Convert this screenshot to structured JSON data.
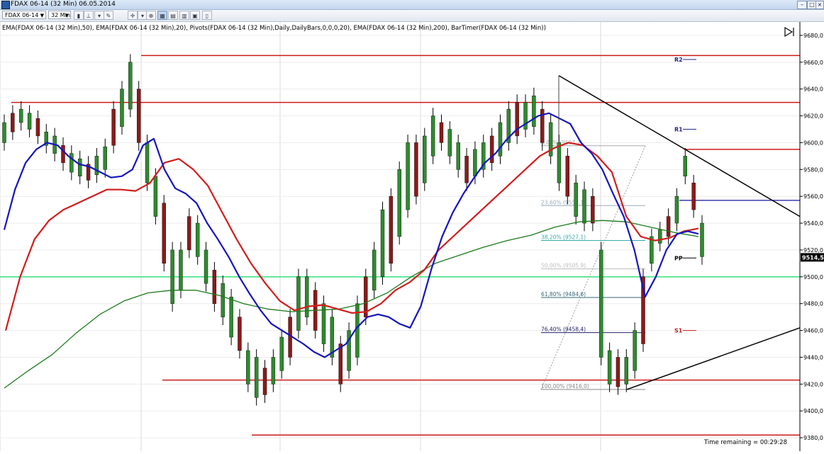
{
  "window": {
    "title": "FDAX 06-14 (32 Min)  06.05.2014"
  },
  "toolbar": {
    "instrument": "FDAX 06-14",
    "interval": "32 Min",
    "icons": [
      "bar-type-icon",
      "crosshair-icon",
      "zoom-icon",
      "properties-icon",
      "chart-style-icon",
      "data-box-icon",
      "template-icon"
    ]
  },
  "chart_data": {
    "type": "candlestick",
    "indicator_label": "EMA(FDAX 06-14 (32 Min),50), EMA(FDAX 06-14 (32 Min),20), Pivots(FDAX 06-14 (32 Min),Daily,DailyBars,0,0,0,20), EMA(FDAX 06-14 (32 Min),200), BarTimer(FDAX 06-14 (32 Min))",
    "y_range": [
      9370,
      9690
    ],
    "y_ticks": [
      "9680,0",
      "9660,0",
      "9640,0",
      "9620,0",
      "9600,0",
      "9580,0",
      "9560,0",
      "9540,0",
      "9520,0",
      "9500,0",
      "9480,0",
      "9460,0",
      "9440,0",
      "9420,0",
      "9400,0",
      "9380,0"
    ],
    "last_price_label": "9514,5",
    "last_price": 9514.5,
    "pivots": [
      {
        "label": "R2",
        "price": 9662
      },
      {
        "label": "R1",
        "price": 9610
      },
      {
        "label": "PP",
        "price": 9514
      },
      {
        "label": "S1",
        "price": 9460
      }
    ],
    "fibonacci": [
      {
        "label": "0,00% (9597,7)",
        "price": 9597.7
      },
      {
        "label": "23,60% (9553,1)",
        "price": 9553.1
      },
      {
        "label": "38,20% (9527,1)",
        "price": 9527.1
      },
      {
        "label": "50,00% (9505,9)",
        "price": 9505.9
      },
      {
        "label": "61,80% (9484,6)",
        "price": 9484.6
      },
      {
        "label": "76,40% (9458,4)",
        "price": 9458.4
      },
      {
        "label": "100,00% (9416,0)",
        "price": 9416.0
      }
    ],
    "horizontal_lines": [
      9665,
      9630,
      9595,
      9557,
      9500,
      9423,
      9382
    ],
    "series": {
      "ema20": [
        9535,
        9565,
        9585,
        9595,
        9600,
        9598,
        9590,
        9584,
        9582,
        9578,
        9574,
        9575,
        9580,
        9598,
        9603,
        9580,
        9566,
        9562,
        9555,
        9540,
        9528,
        9515,
        9500,
        9487,
        9475,
        9465,
        9460,
        9455,
        9450,
        9444,
        9440,
        9445,
        9450,
        9462,
        9470,
        9472,
        9470,
        9465,
        9462,
        9478,
        9506,
        9530,
        9548,
        9562,
        9574,
        9585,
        9592,
        9602,
        9610,
        9615,
        9620,
        9622,
        9618,
        9614,
        9600,
        9592,
        9580,
        9562,
        9545,
        9520,
        9485,
        9500,
        9520,
        9532,
        9534,
        9532
      ],
      "ema50": [
        9460,
        9500,
        9528,
        9542,
        9550,
        9555,
        9560,
        9565,
        9565,
        9564,
        9570,
        9585,
        9588,
        9580,
        9568,
        9548,
        9528,
        9510,
        9495,
        9482,
        9475,
        9478,
        9479,
        9476,
        9473,
        9474,
        9480,
        9490,
        9496,
        9505,
        9520,
        9530,
        9540,
        9550,
        9560,
        9570,
        9580,
        9590,
        9596,
        9600,
        9598,
        9590,
        9578,
        9545,
        9530,
        9527,
        9529,
        9534,
        9536
      ],
      "ema200": [
        9417,
        9430,
        9442,
        9458,
        9472,
        9482,
        9488,
        9490,
        9490,
        9486,
        9480,
        9476,
        9474,
        9475,
        9476,
        9480,
        9488,
        9500,
        9510,
        9516,
        9522,
        9527,
        9531,
        9537,
        9541,
        9542,
        9541,
        9537,
        9533,
        9530
      ]
    },
    "candles": [
      [
        9600,
        9615
      ],
      [
        9608,
        9622
      ],
      [
        9615,
        9625
      ],
      [
        9610,
        9622
      ],
      [
        9605,
        9618
      ],
      [
        9598,
        9608
      ],
      [
        9592,
        9605
      ],
      [
        9585,
        9598
      ],
      [
        9578,
        9592
      ],
      [
        9575,
        9588
      ],
      [
        9572,
        9584
      ],
      [
        9576,
        9590
      ],
      [
        9580,
        9597
      ],
      [
        9598,
        9625
      ],
      [
        9612,
        9640
      ],
      [
        9625,
        9660
      ],
      [
        9600,
        9640
      ],
      [
        9570,
        9600
      ],
      [
        9545,
        9575
      ],
      [
        9510,
        9555
      ],
      [
        9480,
        9520
      ],
      [
        9490,
        9520
      ],
      [
        9520,
        9545
      ],
      [
        9515,
        9540
      ],
      [
        9495,
        9520
      ],
      [
        9480,
        9505
      ],
      [
        9470,
        9495
      ],
      [
        9455,
        9485
      ],
      [
        9445,
        9470
      ],
      [
        9420,
        9445
      ],
      [
        9410,
        9440
      ],
      [
        9412,
        9432
      ],
      [
        9420,
        9440
      ],
      [
        9430,
        9455
      ],
      [
        9440,
        9470
      ],
      [
        9460,
        9500
      ],
      [
        9470,
        9500
      ],
      [
        9460,
        9490
      ],
      [
        9450,
        9480
      ],
      [
        9440,
        9470
      ],
      [
        9420,
        9450
      ],
      [
        9430,
        9460
      ],
      [
        9440,
        9480
      ],
      [
        9470,
        9500
      ],
      [
        9490,
        9520
      ],
      [
        9500,
        9550
      ],
      [
        9510,
        9560
      ],
      [
        9530,
        9580
      ],
      [
        9550,
        9600
      ],
      [
        9560,
        9600
      ],
      [
        9570,
        9605
      ],
      [
        9590,
        9620
      ],
      [
        9600,
        9615
      ],
      [
        9590,
        9610
      ],
      [
        9580,
        9600
      ],
      [
        9570,
        9590
      ],
      [
        9575,
        9595
      ],
      [
        9580,
        9600
      ],
      [
        9585,
        9605
      ],
      [
        9590,
        9615
      ],
      [
        9600,
        9625
      ],
      [
        9605,
        9630
      ],
      [
        9610,
        9630
      ],
      [
        9612,
        9635
      ],
      [
        9600,
        9625
      ],
      [
        9590,
        9615
      ],
      [
        9570,
        9600
      ],
      [
        9560,
        9590
      ],
      [
        9545,
        9570
      ],
      [
        9540,
        9565
      ],
      [
        9540,
        9560
      ],
      [
        9440,
        9520
      ],
      [
        9420,
        9445
      ],
      [
        9418,
        9440
      ],
      [
        9420,
        9440
      ],
      [
        9430,
        9460
      ],
      [
        9450,
        9500
      ],
      [
        9510,
        9530
      ],
      [
        9525,
        9535
      ],
      [
        9530,
        9545
      ],
      [
        9540,
        9560
      ],
      [
        9575,
        9590
      ],
      [
        9550,
        9570
      ],
      [
        9515,
        9540
      ]
    ],
    "trend_lines": [
      "descending resistance",
      "ascending support"
    ],
    "play_icon": "play-forward-icon",
    "timer_label": "Time remaining = 00:29:28"
  }
}
